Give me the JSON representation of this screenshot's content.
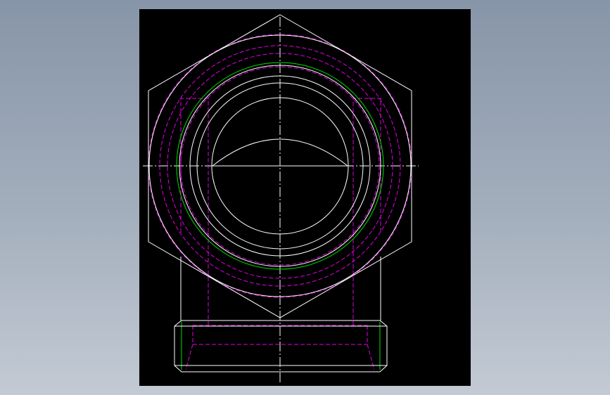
{
  "viewport": {
    "background_top": "#8795a8",
    "background_bottom": "#c3cad4"
  },
  "drawing": {
    "background": "#000000",
    "line_colors": {
      "visible_edge": "#ffffff",
      "hidden_edge": "#e000e0",
      "thread": "#00e000"
    },
    "parts": [
      "hex-nut-outline",
      "bore-circle",
      "thread-circle",
      "hidden-circles",
      "body-neck",
      "threaded-spigot",
      "center-lines"
    ]
  }
}
